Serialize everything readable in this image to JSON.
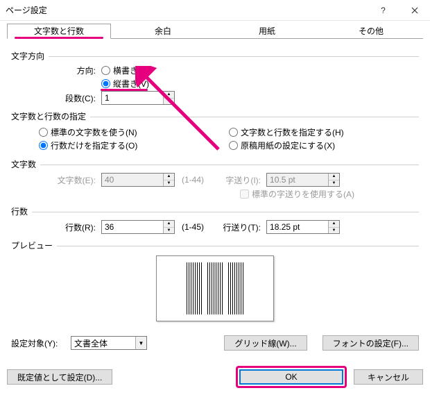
{
  "window": {
    "title": "ページ設定"
  },
  "tabs": {
    "items": [
      {
        "label": "文字数と行数",
        "active": true
      },
      {
        "label": "余白",
        "active": false
      },
      {
        "label": "用紙",
        "active": false
      },
      {
        "label": "その他",
        "active": false
      }
    ]
  },
  "direction": {
    "group": "文字方向",
    "label": "方向:",
    "horizontal": "横書き(Z)",
    "vertical": "縦書き(V)",
    "selected": "vertical",
    "columns_label": "段数(C):",
    "columns_value": "1"
  },
  "grid_spec": {
    "group": "文字数と行数の指定",
    "opt_std": "標準の文字数を使う(N)",
    "opt_spec_both": "文字数と行数を指定する(H)",
    "opt_lines_only": "行数だけを指定する(O)",
    "opt_genkou": "原稿用紙の設定にする(X)",
    "selected": "lines_only"
  },
  "chars": {
    "group": "文字数",
    "label": "文字数(E):",
    "value": "40",
    "range": "(1-44)",
    "pitch_label": "字送り(I):",
    "pitch_value": "10.5 pt",
    "std_pitch": "標準の字送りを使用する(A)"
  },
  "lines": {
    "group": "行数",
    "label": "行数(R):",
    "value": "36",
    "range": "(1-45)",
    "pitch_label": "行送り(T):",
    "pitch_value": "18.25 pt"
  },
  "preview": {
    "group": "プレビュー"
  },
  "apply_to": {
    "label": "設定対象(Y):",
    "value": "文書全体"
  },
  "buttons": {
    "gridlines": "グリッド線(W)...",
    "font": "フォントの設定(F)...",
    "default": "既定値として設定(D)...",
    "ok": "OK",
    "cancel": "キャンセル"
  },
  "colors": {
    "accent": "#e6007e",
    "focus": "#0078d7"
  }
}
